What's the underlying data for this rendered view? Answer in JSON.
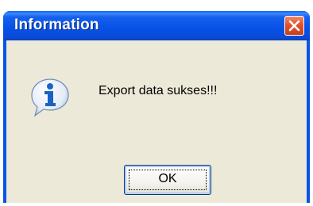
{
  "dialog": {
    "title": "Information",
    "message": "Export data sukses!!!",
    "ok_label": "OK",
    "icon": "info-icon",
    "close_icon": "close-icon"
  },
  "colors": {
    "titlebar": "#0651e6",
    "client": "#ece9d8",
    "close": "#e0522c",
    "icon_blue": "#1a63c6"
  }
}
